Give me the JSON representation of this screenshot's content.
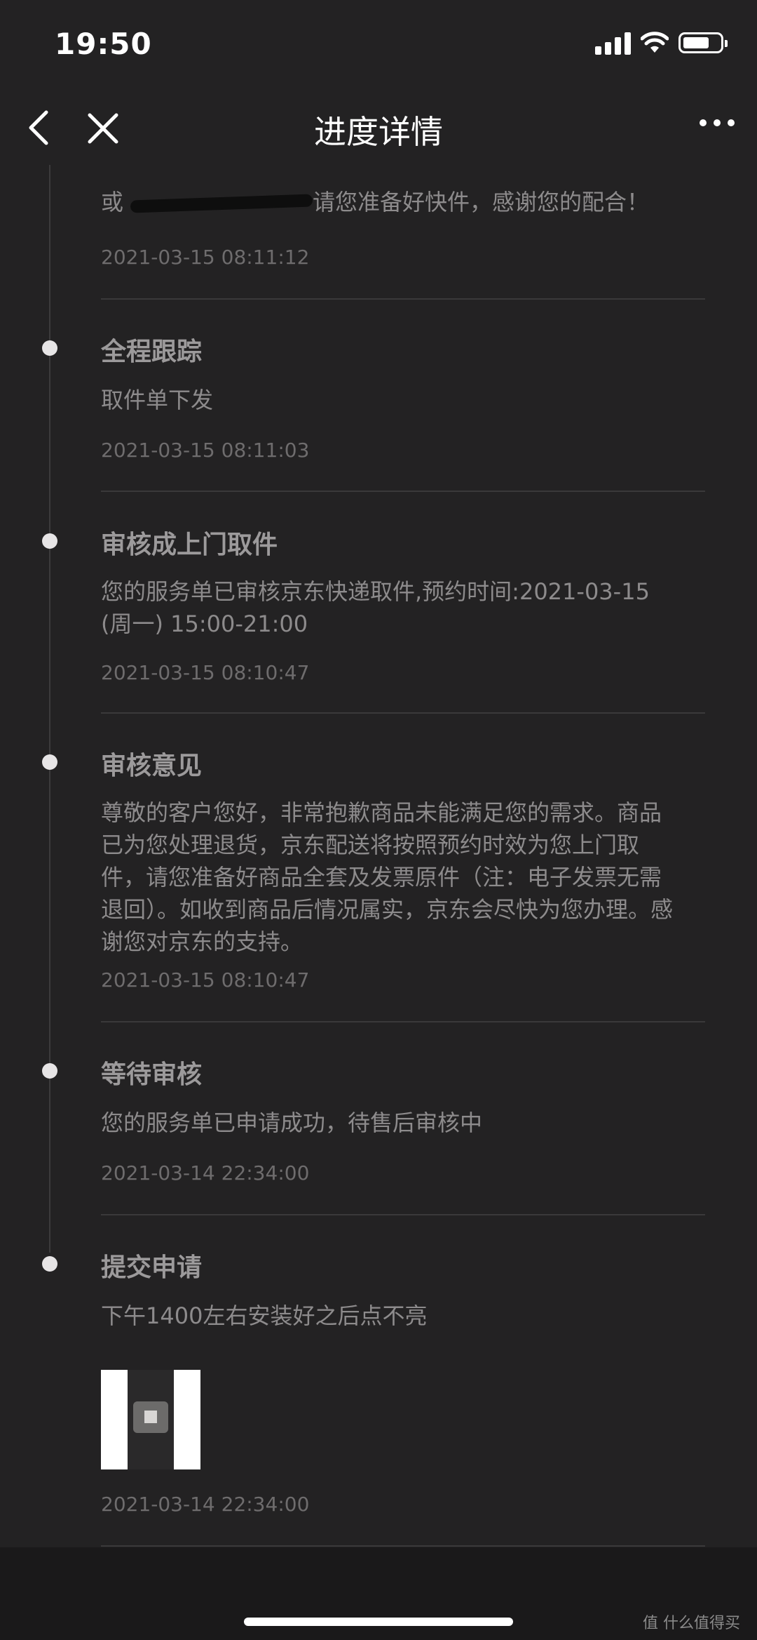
{
  "status_bar": {
    "time": "19:50"
  },
  "nav": {
    "title": "进度详情"
  },
  "entries": [
    {
      "title": "",
      "body_prefix": "或",
      "body_suffix": "请您准备好快件，感谢您的配合！",
      "time": "2021-03-15 08:11:12"
    },
    {
      "title": "全程跟踪",
      "body": "取件单下发",
      "time": "2021-03-15 08:11:03"
    },
    {
      "title": "审核成上门取件",
      "body": "您的服务单已审核京东快递取件,预约时间:2021-03-15 (周一) 15:00-21:00",
      "time": "2021-03-15 08:10:47"
    },
    {
      "title": "审核意见",
      "body": "尊敬的客户您好，非常抱歉商品未能满足您的需求。商品已为您处理退货，京东配送将按照预约时效为您上门取件，请您准备好商品全套及发票原件（注：电子发票无需退回）。如收到商品后情况属实，京东会尽快为您办理。感谢您对京东的支持。",
      "time": "2021-03-15 08:10:47"
    },
    {
      "title": "等待审核",
      "body": "您的服务单已申请成功，待售后审核中",
      "time": "2021-03-14 22:34:00"
    },
    {
      "title": "提交申请",
      "body": "下午1400左右安装好之后点不亮",
      "time": "2021-03-14 22:34:00"
    }
  ],
  "watermark": "值 什么值得买",
  "icons": [
    "back-icon",
    "close-icon",
    "more-icon",
    "signal-icon",
    "wifi-icon",
    "battery-icon"
  ]
}
